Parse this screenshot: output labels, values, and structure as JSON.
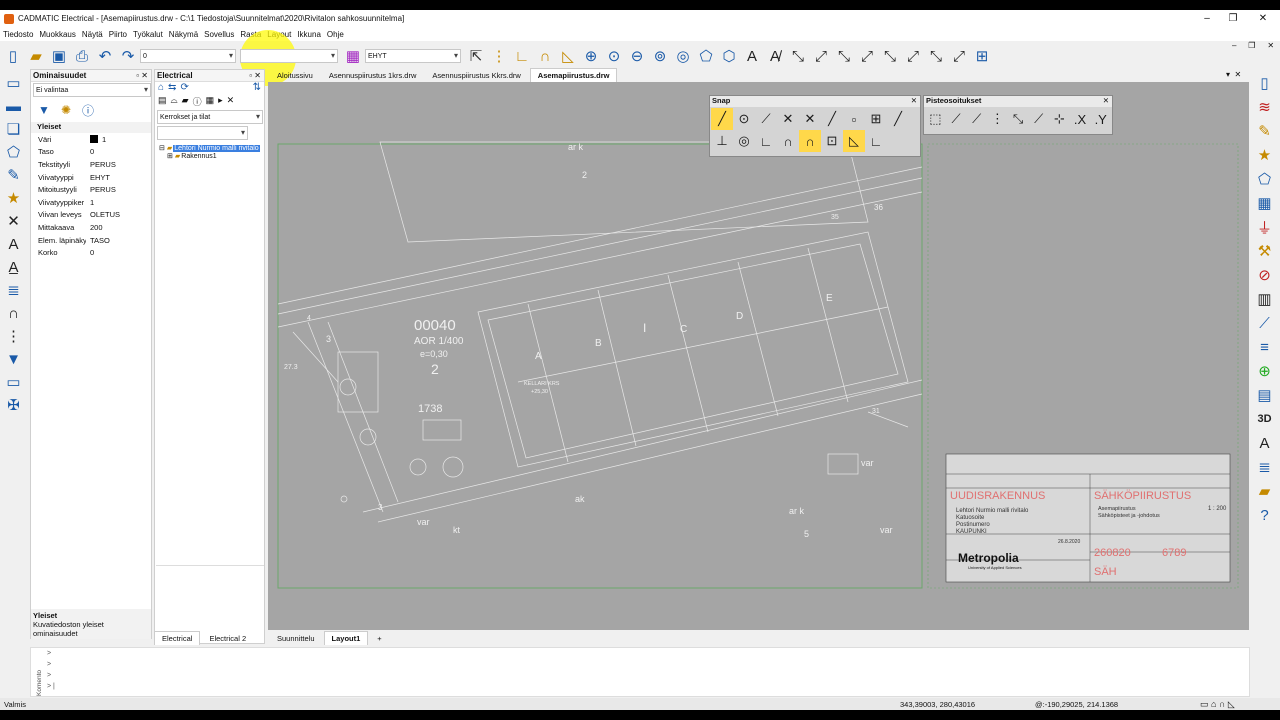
{
  "window": {
    "title": "CADMATIC Electrical - [Asemapiirustus.drw - C:\\1 Tiedostoja\\Suunnitelmat\\2020\\Rivitalon sahkosuunnitelma]"
  },
  "menu": [
    "Tiedosto",
    "Muokkaus",
    "Näytä",
    "Piirto",
    "Työkalut",
    "Näkymä",
    "Sovellus",
    "Rasta",
    "Layout",
    "Ikkuna",
    "Ohje"
  ],
  "toolbar": {
    "layer_value": "0",
    "linetype_value": "EHYT"
  },
  "properties": {
    "title": "Ominaisuudet",
    "selection": "Ei valintaa",
    "section": "Yleiset",
    "rows": [
      {
        "k": "Väri",
        "v": "1"
      },
      {
        "k": "Taso",
        "v": "0"
      },
      {
        "k": "Tekstityyli",
        "v": "PERUS"
      },
      {
        "k": "Viivatyyppi",
        "v": "EHYT"
      },
      {
        "k": "Mitoitustyyli",
        "v": "PERUS"
      },
      {
        "k": "Viivatyyppiker",
        "v": "1"
      },
      {
        "k": "Viivan leveys",
        "v": "OLETUS"
      },
      {
        "k": "Mittakaava",
        "v": "200"
      },
      {
        "k": "Elem. läpinäky",
        "v": "TASO"
      },
      {
        "k": "Korko",
        "v": "0"
      }
    ],
    "help_title": "Yleiset",
    "help_text": "Kuvatiedoston yleiset ominaisuudet"
  },
  "electrical": {
    "title": "Electrical",
    "filter": "Kerrokset ja tilat",
    "tree": [
      "Lehtori Nurmio malli rivitalo",
      "Rakennus1"
    ],
    "tabs": [
      "Electrical",
      "Electrical 2"
    ]
  },
  "doc_tabs": [
    "Aloitussivu",
    "Asennuspiirustus 1krs.drw",
    "Asennuspiirustus Kkrs.drw",
    "Asemapiirustus.drw"
  ],
  "layout_tabs": [
    "Suunnittelu",
    "Layout1",
    "+"
  ],
  "snap": {
    "title": "Snap"
  },
  "points": {
    "title": "Pisteosoitukset",
    "x_label": ".X",
    "y_label": ".Y"
  },
  "drawing": {
    "texts": [
      "ar k",
      "2",
      "00040",
      "AOR 1/400",
      "e=0,30",
      "2",
      "1738",
      "A",
      "B",
      "C",
      "D",
      "E",
      "I",
      "3",
      "27.3",
      "4",
      "36",
      "35",
      "31",
      "var",
      "ak",
      "var",
      "kt",
      "ar k",
      "5",
      "var",
      "3",
      "KELLARI KRS",
      "+25,30"
    ]
  },
  "titleblock": {
    "main_left": "UUDISRAKENNUS",
    "main_right": "SÄHKÖPIIRUSTUS",
    "info1": "Lehtori Nurmio malli rivitalo",
    "info2": "Katuosoite",
    "info3": "Postinumero",
    "info4": "KAUPUNKI",
    "desc1": "Asemapiirustus",
    "desc2": "Sähköpisteet ja -johdotus",
    "scale": "1 : 200",
    "date": "26.8.2020",
    "num1": "260820",
    "num2": "6789",
    "status": "SÄH",
    "logo": "Metropolia",
    "logo_sub": "University of Applied Sciences"
  },
  "cmd_prompt": "Komento",
  "status": {
    "left": "Valmis",
    "coords": "343,39003, 280,43016",
    "delta": "@:-190,29025, 214.1368"
  }
}
